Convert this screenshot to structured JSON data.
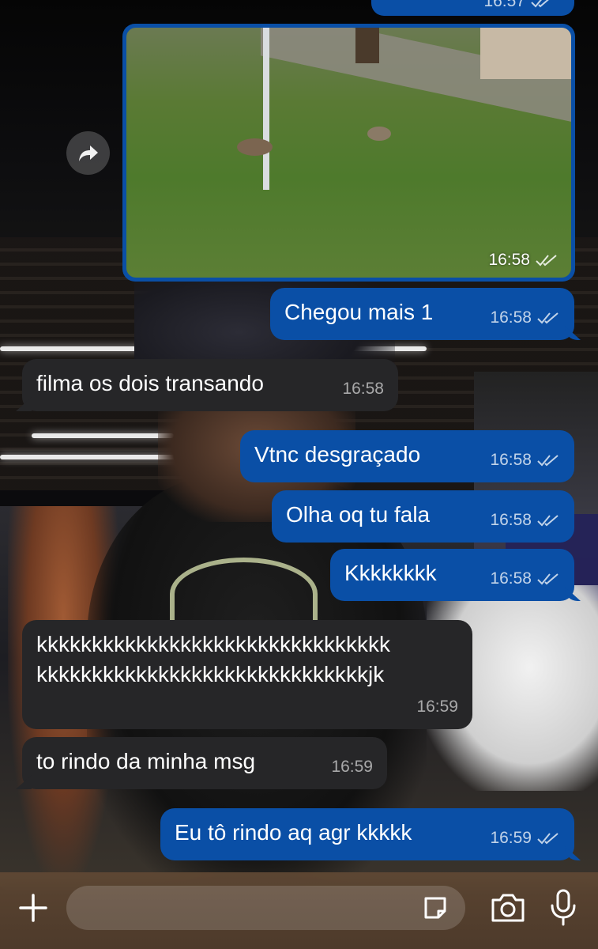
{
  "messages": [
    {
      "id": "m1",
      "direction": "out",
      "text": "Chegou mais 1",
      "time": "16:58",
      "status": "read"
    },
    {
      "id": "m2",
      "direction": "in",
      "text": "filma os dois transando",
      "time": "16:58"
    },
    {
      "id": "m3",
      "direction": "out",
      "text": "Vtnc desgraçado",
      "time": "16:58",
      "status": "read"
    },
    {
      "id": "m4",
      "direction": "out",
      "text": "Olha oq tu fala",
      "time": "16:58",
      "status": "read"
    },
    {
      "id": "m5",
      "direction": "out",
      "text": "Kkkkkkkk",
      "time": "16:58",
      "status": "read"
    },
    {
      "id": "m6",
      "direction": "in",
      "text_line1": "kkkkkkkkkkkkkkkkkkkkkkkkkkkkkkkk",
      "text_line2": "kkkkkkkkkkkkkkkkkkkkkkkkkkkkkkjk",
      "time": "16:59"
    },
    {
      "id": "m7",
      "direction": "in",
      "text": "to rindo da minha msg",
      "time": "16:59"
    },
    {
      "id": "m8",
      "direction": "out",
      "text": "Eu tô rindo aq agr kkkkk",
      "time": "16:59",
      "status": "read"
    }
  ],
  "top_partial": {
    "time": "16:57"
  },
  "photo_message": {
    "time": "16:58",
    "status": "read"
  },
  "composer": {
    "placeholder": "",
    "value": ""
  },
  "icons": {
    "forward": "forward-icon",
    "plus": "plus-icon",
    "sticker": "sticker-icon",
    "camera": "camera-icon",
    "mic": "microphone-icon",
    "read": "double-check-icon"
  },
  "colors": {
    "outgoing_bubble": "#0a4fa6",
    "incoming_bubble": "#262628",
    "text": "#ffffff"
  }
}
